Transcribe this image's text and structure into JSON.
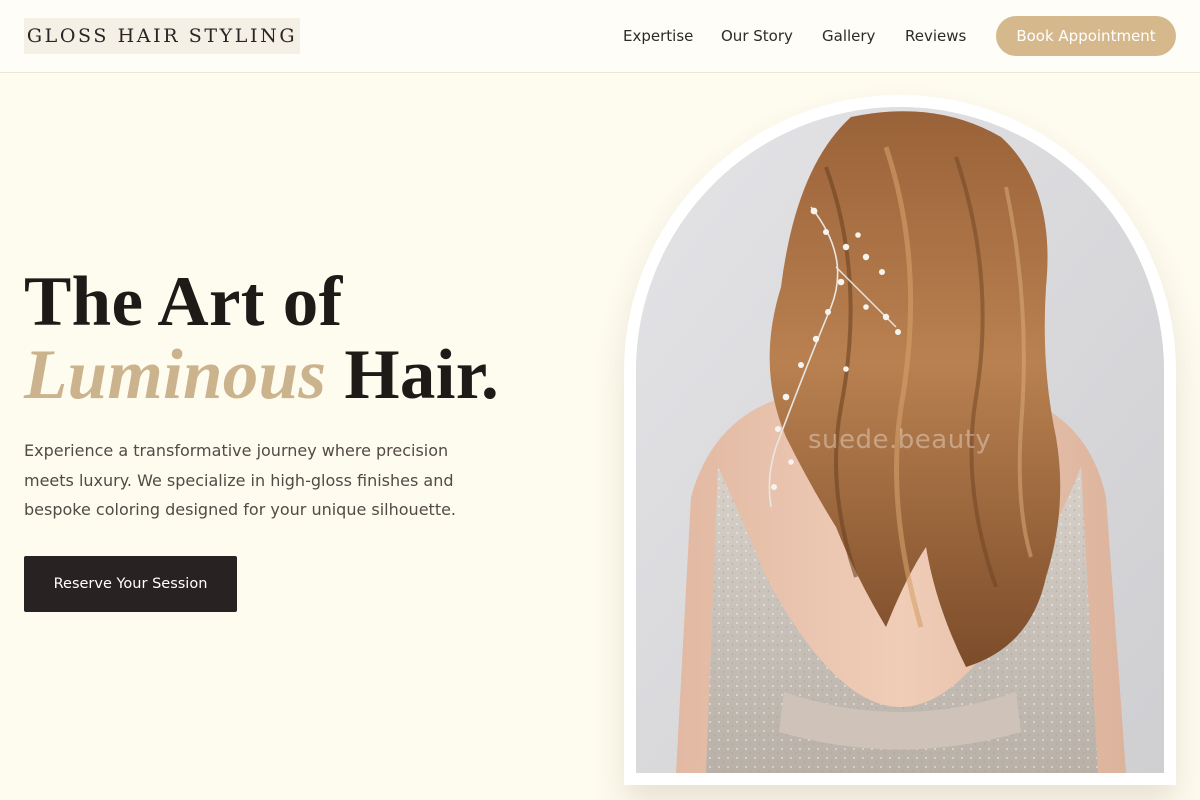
{
  "header": {
    "logo": "GLOSS HAIR STYLING",
    "nav": [
      {
        "label": "Expertise"
      },
      {
        "label": "Our Story"
      },
      {
        "label": "Gallery"
      },
      {
        "label": "Reviews"
      }
    ],
    "cta_label": "Book Appointment"
  },
  "hero": {
    "title_line1": "The Art of",
    "title_accent": "Luminous",
    "title_end": "Hair.",
    "description": "Experience a transformative journey where precision meets luxury. We specialize in high-gloss finishes and bespoke coloring designed for your unique silhouette.",
    "cta_label": "Reserve Your Session"
  },
  "photo": {
    "watermark": "suede.beauty"
  },
  "colors": {
    "background": "#fefbef",
    "accent": "#d6b88d",
    "title_accent": "#cbb38d",
    "dark_button": "#282322"
  }
}
